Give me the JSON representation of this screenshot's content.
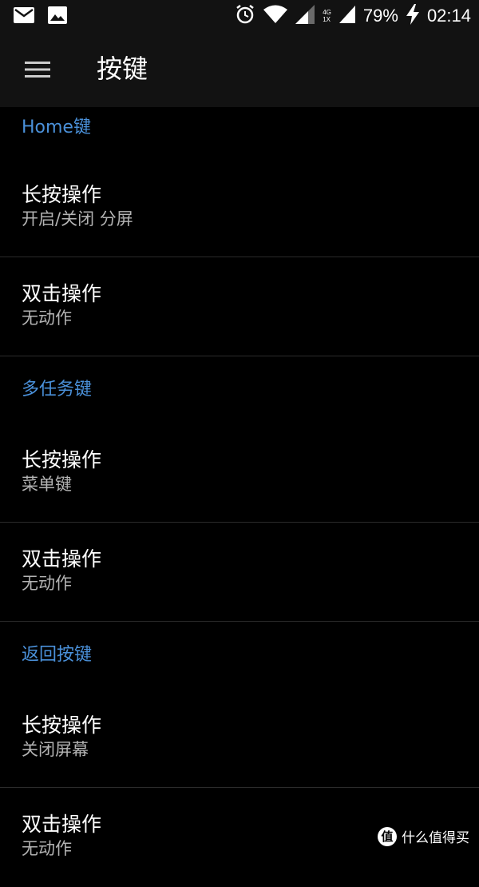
{
  "status_bar": {
    "battery": "79%",
    "time": "02:14",
    "net_top": "4G",
    "net_bottom": "1X",
    "icons": [
      "mail-icon",
      "image-icon",
      "alarm-icon",
      "wifi-icon",
      "signal-icon",
      "battery-charging-icon"
    ]
  },
  "app_bar": {
    "title": "按键",
    "menu_icon": "hamburger-menu-icon"
  },
  "sections": [
    {
      "header": "Home键",
      "items": [
        {
          "title": "长按操作",
          "subtitle": "开启/关闭 分屏"
        },
        {
          "title": "双击操作",
          "subtitle": "无动作"
        }
      ]
    },
    {
      "header": "多任务键",
      "items": [
        {
          "title": "长按操作",
          "subtitle": "菜单键"
        },
        {
          "title": "双击操作",
          "subtitle": "无动作"
        }
      ]
    },
    {
      "header": "返回按键",
      "items": [
        {
          "title": "长按操作",
          "subtitle": "关闭屏幕"
        },
        {
          "title": "双击操作",
          "subtitle": "无动作"
        }
      ]
    }
  ],
  "watermark": {
    "logo": "值",
    "text": "什么值得买"
  },
  "colors": {
    "accent": "#4a90d9",
    "background": "#000000",
    "bar": "#121212",
    "divider": "#2b2b2b",
    "subtitle": "#b3b3b3"
  }
}
